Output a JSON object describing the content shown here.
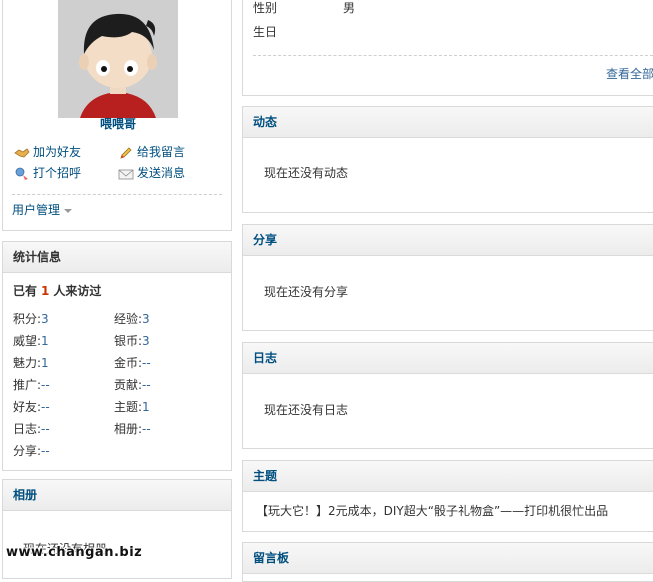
{
  "profile": {
    "username": "喂喂哥",
    "actions": {
      "add_friend": "加为好友",
      "leave_message": "给我留言",
      "greet": "打个招呼",
      "send_message": "发送消息"
    },
    "user_management": "用户管理"
  },
  "stats": {
    "title": "统计信息",
    "visitors_prefix": "已有",
    "visitors_count": "1",
    "visitors_suffix": "人来访过",
    "items": [
      {
        "label": "积分:",
        "value": "3"
      },
      {
        "label": "经验:",
        "value": "3"
      },
      {
        "label": "威望:",
        "value": "1"
      },
      {
        "label": "银币:",
        "value": "3"
      },
      {
        "label": "魅力:",
        "value": "1"
      },
      {
        "label": "金币:",
        "value": "--"
      },
      {
        "label": "推广:",
        "value": "--"
      },
      {
        "label": "贡献:",
        "value": "--"
      },
      {
        "label": "好友:",
        "value": "--"
      },
      {
        "label": "主题:",
        "value": "1"
      },
      {
        "label": "日志:",
        "value": "--"
      },
      {
        "label": "相册:",
        "value": "--"
      },
      {
        "label": "分享:",
        "value": "--"
      }
    ]
  },
  "album": {
    "title": "相册",
    "empty_text": "现在还没有相册"
  },
  "info": {
    "gender_label": "性别",
    "gender_value": "男",
    "birthday_label": "生日",
    "view_all": "查看全部"
  },
  "sections": {
    "feed": {
      "title": "动态",
      "empty_text": "现在还没有动态"
    },
    "share": {
      "title": "分享",
      "empty_text": "现在还没有分享"
    },
    "blog": {
      "title": "日志",
      "empty_text": "现在还没有日志"
    },
    "topics": {
      "title": "主题",
      "item": "【玩大它！】2元成本，DIY超大“骰子礼物盒”——打印机很忙出品"
    },
    "guestbook": {
      "title": "留言板"
    }
  },
  "watermark": "www.changan.biz",
  "colors": {
    "link": "#336699",
    "header_text": "#004f7f",
    "count_highlight": "#cc3300"
  }
}
